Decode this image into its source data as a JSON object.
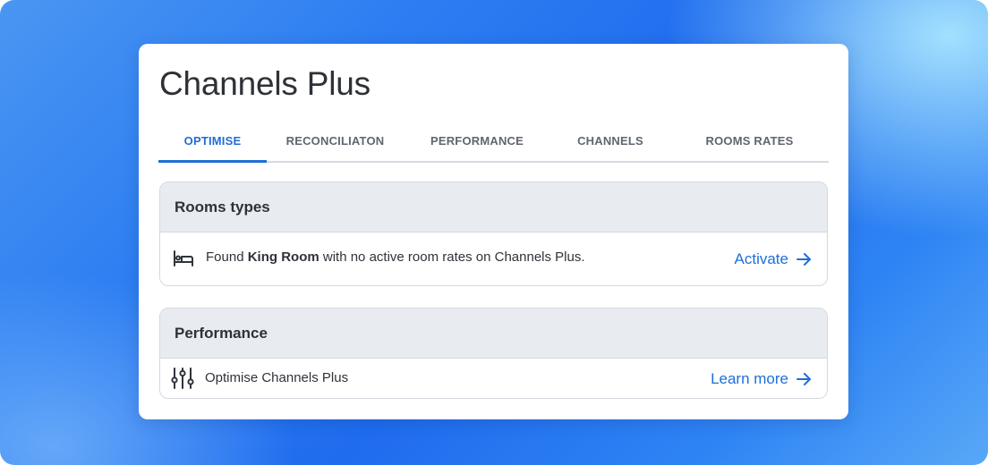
{
  "app": {
    "title": "Channels Plus"
  },
  "tabs": [
    {
      "label": "OPTIMISE",
      "active": true
    },
    {
      "label": "RECONCILIATON",
      "active": false
    },
    {
      "label": "PERFORMANCE",
      "active": false
    },
    {
      "label": "CHANNELS",
      "active": false
    },
    {
      "label": "ROOMS RATES",
      "active": false
    }
  ],
  "rooms_panel": {
    "heading": "Rooms types",
    "icon": "bed-icon",
    "message_prefix": "Found ",
    "room_name": "King Room",
    "message_suffix": " with no active room rates on Channels Plus.",
    "action_label": "Activate",
    "action_icon": "arrow-right-icon"
  },
  "performance_panel": {
    "heading": "Performance",
    "icon": "sliders-icon",
    "message": "Optimise Channels Plus",
    "action_label": "Learn more",
    "action_icon": "arrow-right-icon"
  },
  "colors": {
    "accent": "#1e6fd6",
    "panel_header_bg": "#e8ebf0",
    "text": "#2e3136",
    "tab_inactive": "#5f6670",
    "background_blue": "#1f6cee"
  }
}
